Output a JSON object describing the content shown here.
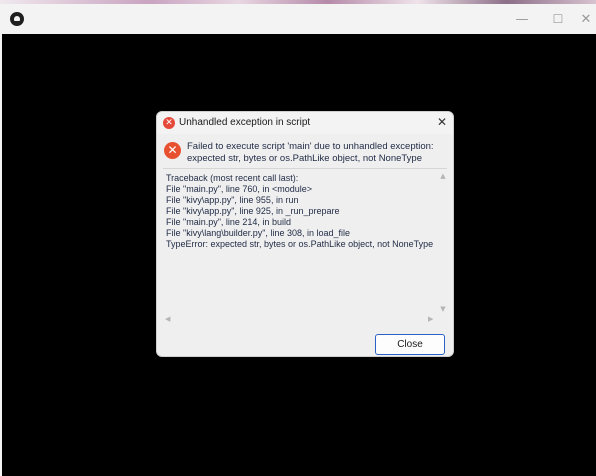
{
  "window": {
    "minimize_glyph": "—",
    "maximize_glyph": "☐",
    "close_glyph": "✕"
  },
  "dialog": {
    "title": "Unhandled exception in script",
    "close_glyph": "✕",
    "message_lines": [
      "Failed to execute script 'main' due to unhandled exception:",
      "expected str, bytes or os.PathLike object, not NoneType"
    ],
    "traceback": [
      "Traceback (most recent call last):",
      "  File \"main.py\", line 760, in <module>",
      "  File \"kivy\\app.py\", line 955, in run",
      "  File \"kivy\\app.py\", line 925, in _run_prepare",
      "  File \"main.py\", line 214, in build",
      "  File \"kivy\\lang\\builder.py\", line 308, in load_file",
      "TypeError: expected str, bytes or os.PathLike object, not NoneType"
    ],
    "close_button_label": "Close",
    "error_icon_glyph": "✕"
  },
  "colors": {
    "error_red": "#e5493a",
    "accent_blue": "#2a62c9",
    "client_background": "#000000"
  }
}
